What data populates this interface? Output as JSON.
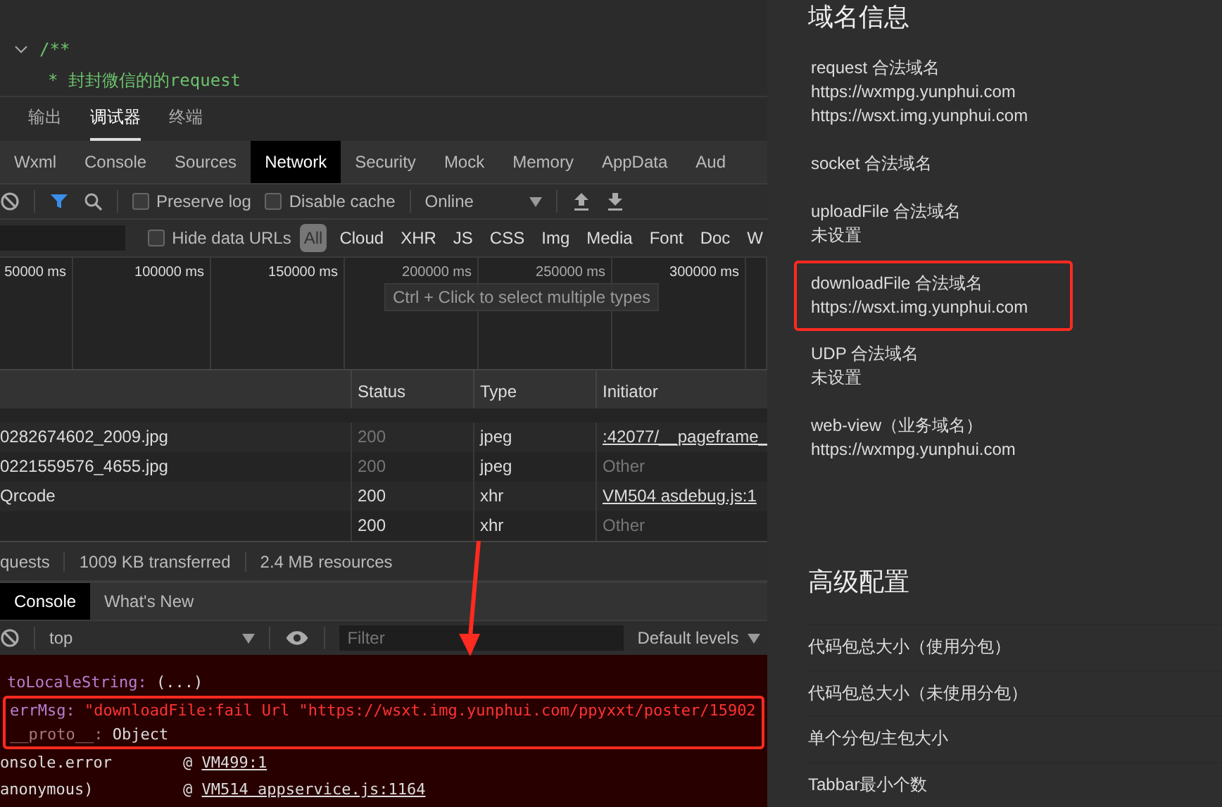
{
  "editor": {
    "lines": [
      {
        "text": "/**",
        "foldable": true
      },
      {
        "text": "* 封封微信的的request",
        "foldable": false
      }
    ]
  },
  "panel_tabs": [
    {
      "label": "输出",
      "selected": false
    },
    {
      "label": "调试器",
      "selected": true
    },
    {
      "label": "终端",
      "selected": false
    }
  ],
  "devtools_tabs": [
    {
      "label": "Wxml",
      "selected": false
    },
    {
      "label": "Console",
      "selected": false
    },
    {
      "label": "Sources",
      "selected": false
    },
    {
      "label": "Network",
      "selected": true
    },
    {
      "label": "Security",
      "selected": false
    },
    {
      "label": "Mock",
      "selected": false
    },
    {
      "label": "Memory",
      "selected": false
    },
    {
      "label": "AppData",
      "selected": false
    },
    {
      "label": "Aud",
      "selected": false
    }
  ],
  "toolbar": {
    "checkboxes": [
      {
        "label": "Preserve log",
        "checked": false
      },
      {
        "label": "Disable cache",
        "checked": false
      }
    ],
    "throttling": "Online"
  },
  "filter_bar": {
    "hide_data_urls": {
      "label": "Hide data URLs",
      "checked": false
    },
    "types": [
      {
        "label": "All",
        "selected": true
      },
      {
        "label": "Cloud",
        "selected": false
      },
      {
        "label": "XHR",
        "selected": false
      },
      {
        "label": "JS",
        "selected": false
      },
      {
        "label": "CSS",
        "selected": false
      },
      {
        "label": "Img",
        "selected": false
      },
      {
        "label": "Media",
        "selected": false
      },
      {
        "label": "Font",
        "selected": false
      },
      {
        "label": "Doc",
        "selected": false
      },
      {
        "label": "W",
        "selected": false
      }
    ]
  },
  "timeline": {
    "ticks": [
      "50000 ms",
      "100000 ms",
      "150000 ms",
      "200000 ms",
      "250000 ms",
      "300000 ms"
    ],
    "tooltip": "Ctrl + Click to select multiple types"
  },
  "table": {
    "columns": [
      "Status",
      "Type",
      "Initiator"
    ],
    "rows": [
      {
        "name": "0282674602_2009.jpg",
        "status": "200",
        "cached": true,
        "type": "jpeg",
        "initiator": ":42077/__pageframe_",
        "link": true
      },
      {
        "name": "0221559576_4655.jpg",
        "status": "200",
        "cached": true,
        "type": "jpeg",
        "initiator": "Other",
        "link": false
      },
      {
        "name": "Qrcode",
        "status": "200",
        "cached": false,
        "type": "xhr",
        "initiator": "VM504 asdebug.js:1",
        "link": true
      },
      {
        "status": "200",
        "cached": false,
        "type": "xhr",
        "initiator": "Other",
        "link": false
      }
    ]
  },
  "summary": [
    "quests",
    "1009 KB transferred",
    "2.4 MB resources"
  ],
  "drawer_tabs": [
    {
      "label": "Console",
      "selected": true
    },
    {
      "label": "What's New",
      "selected": false
    }
  ],
  "console_toolbar": {
    "context": "top",
    "filter_placeholder": "Filter",
    "levels": "Default levels"
  },
  "console_lines": [
    {
      "kind": "property",
      "key": "toLocaleString:",
      "value": "(...)",
      "string": false,
      "highlighted": false
    },
    {
      "kind": "property",
      "key": "errMsg:",
      "value": "\"downloadFile:fail Url \"https://wsxt.img.yunphui.com/ppyxxt/poster/15902",
      "string": true,
      "highlighted": true
    },
    {
      "kind": "property",
      "key": "__proto__:",
      "value": "Object",
      "string": false,
      "highlighted": true
    },
    {
      "kind": "frame",
      "fn": "onsole.error",
      "at": "@",
      "location": "VM499:1",
      "highlighted": false
    },
    {
      "kind": "frame",
      "fn": "anonymous)",
      "at": "@",
      "location": "VM514 appservice.js:1164",
      "highlighted": false
    }
  ],
  "domain_info": {
    "title": "域名信息",
    "groups": [
      {
        "label": "request 合法域名",
        "values": [
          "https://wxmpg.yunphui.com",
          "https://wsxt.img.yunphui.com"
        ],
        "highlighted": false
      },
      {
        "label": "socket 合法域名",
        "highlighted": false
      },
      {
        "label": "uploadFile 合法域名",
        "values": [
          "未设置"
        ],
        "highlighted": false
      },
      {
        "label": "downloadFile 合法域名",
        "values": [
          "https://wsxt.img.yunphui.com"
        ],
        "highlighted": true
      },
      {
        "label": "UDP 合法域名",
        "values": [
          "未设置"
        ],
        "highlighted": false
      },
      {
        "label": "web-view（业务域名）",
        "values": [
          "https://wxmpg.yunphui.com"
        ],
        "highlighted": false
      }
    ]
  },
  "advanced": {
    "title": "高级配置",
    "items": [
      "代码包总大小（使用分包）",
      "代码包总大小（未使用分包）",
      "单个分包/主包大小",
      "Tabbar最小个数"
    ]
  }
}
